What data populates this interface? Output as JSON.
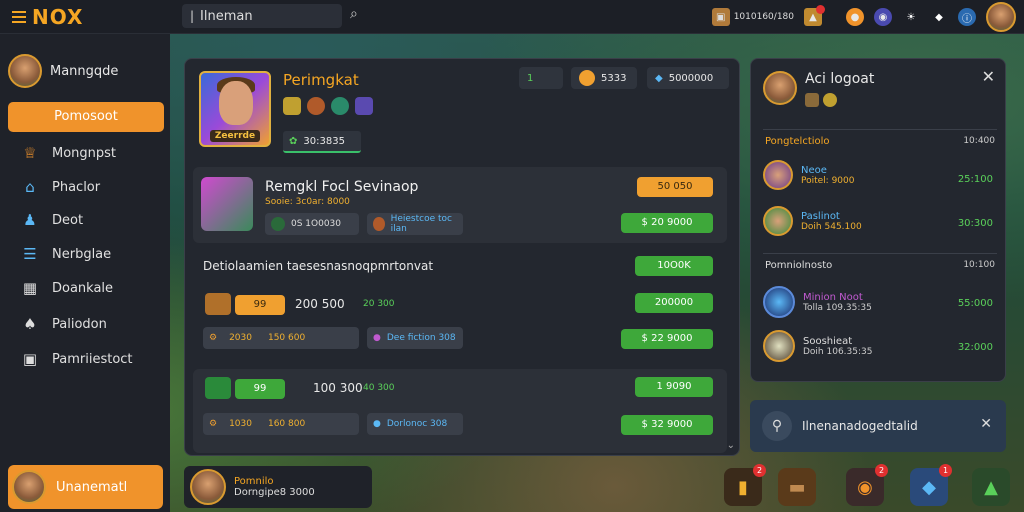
{
  "topbar": {
    "logo": "NOX",
    "search_value": "Ilneman",
    "resources": [
      {
        "icon": "ticket-icon",
        "value": "1010160/180"
      },
      {
        "icon": "chest-icon",
        "value": ""
      }
    ]
  },
  "sidebar": {
    "profile_name": "Manngqde",
    "active_item": "Pomosoot",
    "items": [
      {
        "label": "Mongnpst",
        "icon": "crown-icon"
      },
      {
        "label": "Phaclor",
        "icon": "house-icon"
      },
      {
        "label": "Deot",
        "icon": "person-icon"
      },
      {
        "label": "Nerbglae",
        "icon": "chat-icon"
      },
      {
        "label": "Doankale",
        "icon": "clipboard-icon"
      },
      {
        "label": "Paliodon",
        "icon": "user-icon"
      },
      {
        "label": "Pamriiestoct",
        "icon": "camera-icon"
      }
    ],
    "bottom_user": "Unanematl"
  },
  "main": {
    "hero_name": "Perimgkat",
    "hero_plate": "Zeerrde",
    "hero_xp": "30:3835",
    "stats": [
      {
        "value": "1"
      },
      {
        "value": "5333"
      },
      {
        "value": "5000000"
      }
    ],
    "featured": {
      "title": "Remgkl Focl Sevinaop",
      "sub": "Sooie: 3c0ar: 8000",
      "tag1": "0S 1O0030",
      "tag2": "Heiestcoe toc ilan",
      "orange": "50 050",
      "price": "$ 20 9000"
    },
    "section_label": "Detiolaamien taesesnasnoqpmrtonvat",
    "section_btn": "10O0K",
    "rows": [
      {
        "amount": "200 500",
        "level": "99",
        "green": "20 300",
        "tag_a": "2030",
        "tag_gold": "150 600",
        "tag_b": "Dee fiction 308",
        "btn_top": "200000",
        "btn_bottom": "$ 22 9000"
      },
      {
        "amount": "100 300",
        "level": "99",
        "green": "40 300",
        "tag_a": "1030",
        "tag_gold": "160 800",
        "tag_b": "Dorlonoc 308",
        "btn_top": "1 9090",
        "btn_bottom": "$ 32 9000"
      }
    ]
  },
  "right": {
    "title": "Aci logoat",
    "sec1": {
      "head": "Pongtelctiolo",
      "head_r": "10:400"
    },
    "items1": [
      {
        "name": "Neoe",
        "sub": "Poitel: 9000",
        "val": "25:100"
      },
      {
        "name": "Paslinot",
        "sub": "Doih 545.100",
        "val": "30:300"
      }
    ],
    "sec2": {
      "head": "Pomniolnosto",
      "head_r": "10:100"
    },
    "items2": [
      {
        "name": "Minion Noot",
        "sub": "Tolla 109.35:35",
        "val": "55:000"
      },
      {
        "name": "Sooshieat",
        "sub": "Doih 106.35:35",
        "val": "32:000"
      }
    ]
  },
  "notification": {
    "text": "Ilnenanadogedtalid"
  },
  "bottom": {
    "name": "Pomnilo",
    "sub": "Dorngipe8 3000"
  },
  "dock": [
    {
      "icon": "gold-bars-icon",
      "badge": "2"
    },
    {
      "icon": "wood-icon",
      "badge": ""
    },
    {
      "icon": "orb-icon",
      "badge": "2"
    },
    {
      "icon": "gem-icon",
      "badge": "1"
    },
    {
      "icon": "potion-icon",
      "badge": ""
    }
  ]
}
